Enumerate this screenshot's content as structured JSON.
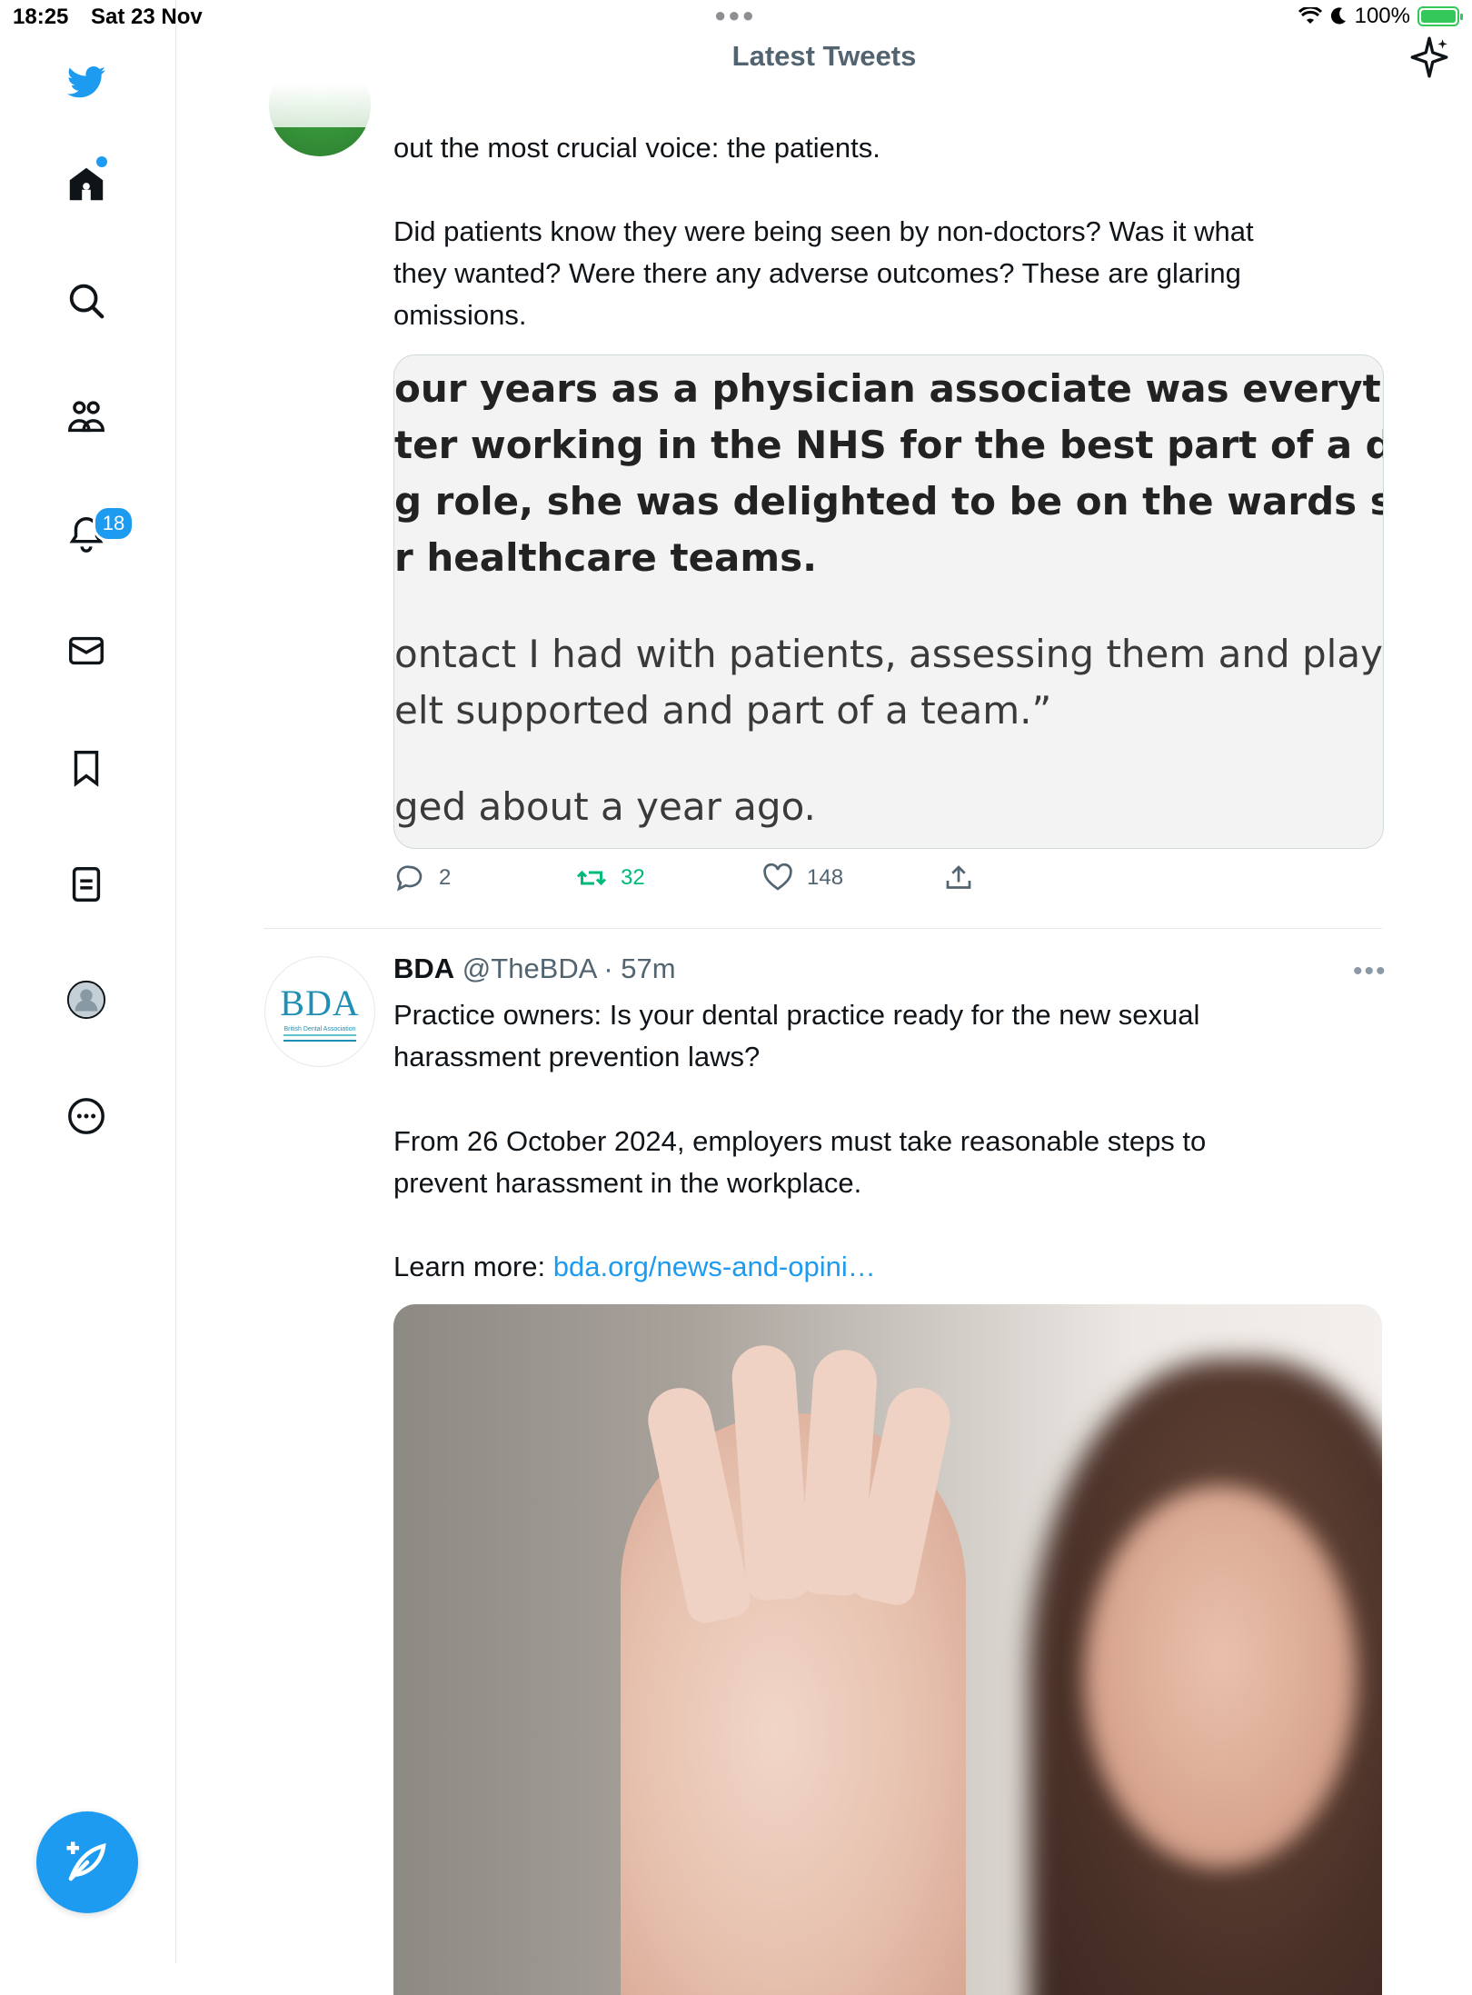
{
  "status_bar": {
    "time": "18:25",
    "date": "Sat 23 Nov",
    "battery": "100%"
  },
  "sidebar": {
    "items": [
      {
        "name": "twitter-logo-icon"
      },
      {
        "name": "home-icon"
      },
      {
        "name": "search-icon"
      },
      {
        "name": "communities-icon"
      },
      {
        "name": "notifications-icon",
        "badge": "18"
      },
      {
        "name": "messages-icon"
      },
      {
        "name": "bookmarks-icon"
      },
      {
        "name": "lists-icon"
      },
      {
        "name": "profile-icon"
      },
      {
        "name": "more-icon"
      }
    ],
    "compose_icon": "feather-plus-icon"
  },
  "header": {
    "title": "Latest Tweets",
    "sparkle_icon": "sparkle-icon"
  },
  "tweet1": {
    "text_lines": [
      "out the most crucial voice: the patients.",
      "",
      "Did patients know they were being seen by non-doctors? Was it what",
      "they wanted? Were there any adverse outcomes? These are glaring",
      "omissions."
    ],
    "quote_lines": {
      "l1": "our years as a physician associate was everything sh",
      "l2": "ter working in the NHS for the best part of a decade",
      "l3": "g role, she was delighted to be on the wards suppor",
      "l4": "r healthcare teams.",
      "l5": "ontact I had with patients, assessing them and playir",
      "l6": "elt supported and part of a team.”",
      "l7": "ged about a year ago."
    },
    "actions": {
      "reply": "2",
      "retweet": "32",
      "like": "148"
    }
  },
  "tweet2": {
    "name": "BDA",
    "handle": "@TheBDA",
    "time": "· 57m",
    "avatar_logo": "BDA",
    "avatar_sub": "British Dental Association",
    "text_p1_l1": "Practice owners: Is your dental practice ready for the new sexual",
    "text_p1_l2": "harassment prevention laws?",
    "text_p2_l1": "From 26 October 2024, employers must take reasonable steps to",
    "text_p2_l2": "prevent harassment in the workplace.",
    "learn_more": "Learn more: ",
    "link": "bda.org/news-and-opini…"
  }
}
